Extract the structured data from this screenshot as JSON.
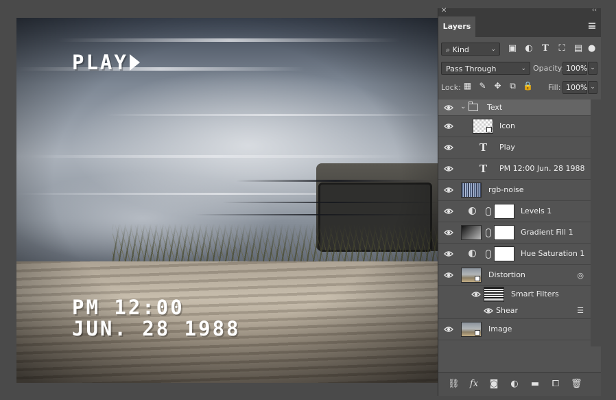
{
  "canvas": {
    "osd_play": "PLAY",
    "osd_time_line1": "PM 12:00",
    "osd_time_line2": "JUN. 28 1988"
  },
  "panel": {
    "tab_label": "Layers",
    "filter": {
      "kind_label": "Kind"
    },
    "blend_mode": "Pass Through",
    "opacity_label": "Opacity:",
    "opacity_value": "100%",
    "lock_label": "Lock:",
    "fill_label": "Fill:",
    "fill_value": "100%",
    "layers": [
      {
        "name": "Text",
        "type": "group",
        "visible": true
      },
      {
        "name": "Icon",
        "type": "smart-object",
        "visible": true
      },
      {
        "name": "Play",
        "type": "text",
        "visible": true
      },
      {
        "name": "PM 12:00 Jun. 28 1988",
        "type": "text",
        "visible": true
      },
      {
        "name": "rgb-noise",
        "type": "pixel",
        "visible": true
      },
      {
        "name": "Levels 1",
        "type": "adjustment",
        "visible": true
      },
      {
        "name": "Gradient Fill 1",
        "type": "fill",
        "visible": true
      },
      {
        "name": "Hue Saturation 1",
        "type": "adjustment",
        "visible": true
      },
      {
        "name": "Distortion",
        "type": "smart-object",
        "visible": true
      },
      {
        "name": "Smart Filters",
        "type": "smart-filters",
        "visible": true
      },
      {
        "name": "Shear",
        "type": "filter",
        "visible": true
      },
      {
        "name": "Image",
        "type": "smart-object",
        "visible": true
      }
    ],
    "footer_icons": [
      "link-icon",
      "fx-icon",
      "mask-icon",
      "adjustment-icon",
      "folder-icon",
      "new-layer-icon",
      "trash-icon"
    ],
    "footer_fx_label": "fx"
  }
}
